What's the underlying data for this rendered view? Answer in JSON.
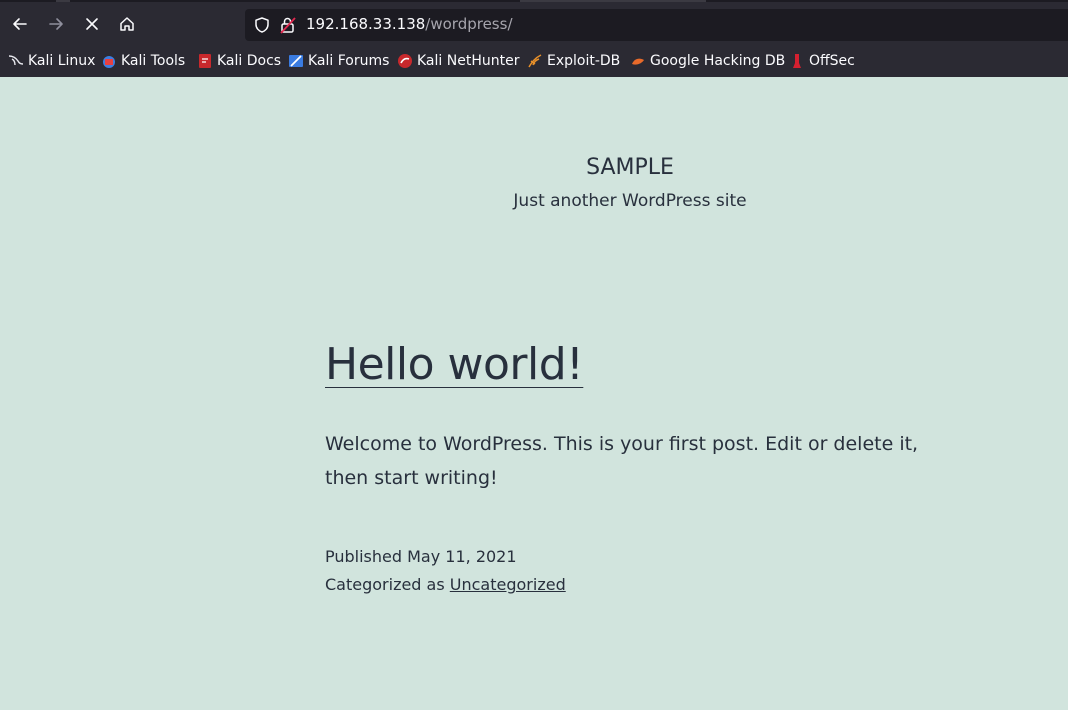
{
  "browser": {
    "url_host": "192.168.33.138",
    "url_path": "/wordpress/",
    "bookmarks": [
      {
        "label": "Kali Linux",
        "icon": "kali-dragon-icon"
      },
      {
        "label": "Kali Tools",
        "icon": "kali-tools-icon"
      },
      {
        "label": "Kali Docs",
        "icon": "kali-docs-icon"
      },
      {
        "label": "Kali Forums",
        "icon": "kali-forums-icon"
      },
      {
        "label": "Kali NetHunter",
        "icon": "nethunter-icon"
      },
      {
        "label": "Exploit-DB",
        "icon": "exploit-db-icon"
      },
      {
        "label": "Google Hacking DB",
        "icon": "ghdb-icon"
      },
      {
        "label": "OffSec",
        "icon": "offsec-icon"
      }
    ]
  },
  "site": {
    "title": "SAMPLE",
    "description": "Just another WordPress site"
  },
  "post": {
    "title": "Hello world!",
    "body": "Welcome to WordPress. This is your first post. Edit or delete it, then start writing!",
    "published_prefix": "Published",
    "published_date": "May 11, 2021",
    "category_prefix": "Categorized as",
    "category": "Uncategorized"
  },
  "colors": {
    "page_bg": "#d1e4dd",
    "chrome_bg": "#2b2a33",
    "text": "#28303d"
  }
}
